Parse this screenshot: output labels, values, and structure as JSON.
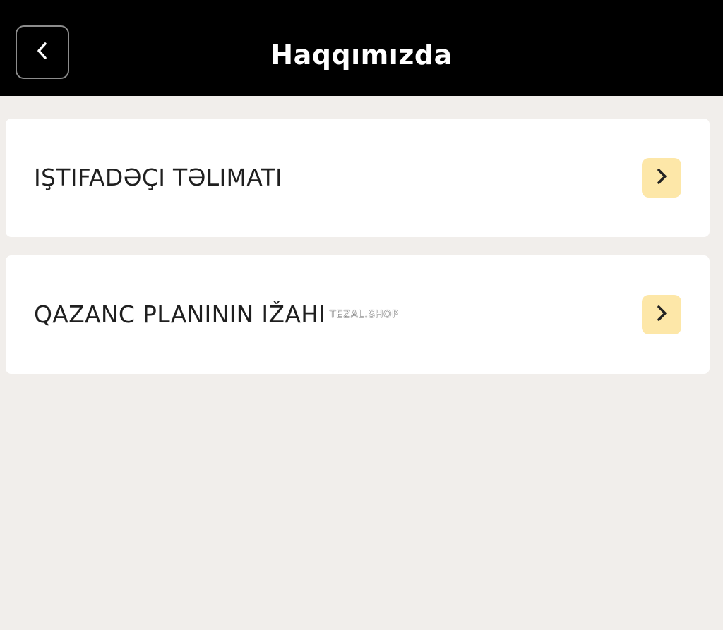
{
  "header": {
    "title": "Haqqımızda",
    "back_icon": "chevron-left-icon"
  },
  "menu": {
    "items": [
      {
        "label": "IŞTIFADƏÇI TƏLIMATI",
        "icon": "chevron-right-icon"
      },
      {
        "label": "QAZANC PLANININ IŽAHI",
        "icon": "chevron-right-icon"
      }
    ]
  },
  "watermark": "TEZAL.SHOP",
  "colors": {
    "header_bg": "#000000",
    "page_bg": "#f1eeeb",
    "card_bg": "#ffffff",
    "chevron_bg": "#fde7a8"
  }
}
